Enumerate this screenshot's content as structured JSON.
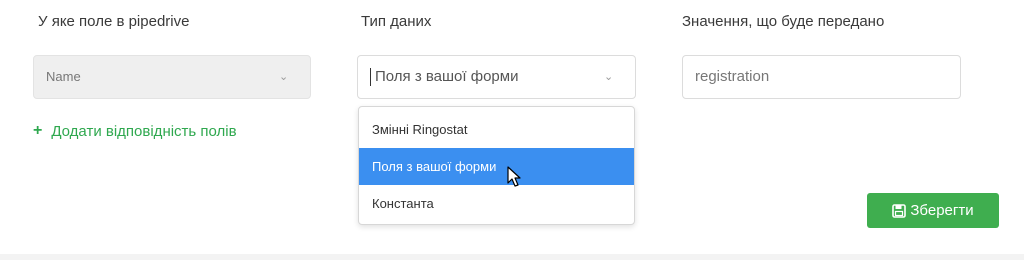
{
  "columns": {
    "pipedrive_field_label": "У яке поле в pipedrive",
    "data_type_label": "Тип даних",
    "value_label": "Значення, що буде передано"
  },
  "row": {
    "pipedrive_field_value": "Name",
    "data_type_value": "Поля з вашої форми",
    "value": "registration"
  },
  "dropdown": {
    "options": [
      {
        "label": "Змінні Ringostat",
        "selected": false
      },
      {
        "label": "Поля з вашої форми",
        "selected": true
      },
      {
        "label": "Константа",
        "selected": false
      }
    ]
  },
  "actions": {
    "add_mapping_label": "Додати відповідність полів",
    "save_label": "Зберегти"
  },
  "icons": {
    "chevron": "chevron-down-icon",
    "plus": "plus-icon",
    "save": "floppy-disk-icon",
    "cursor": "mouse-cursor-icon"
  },
  "colors": {
    "accent_green": "#3fae4f",
    "link_green": "#2fa84f",
    "selected_blue": "#3b8ff0"
  }
}
